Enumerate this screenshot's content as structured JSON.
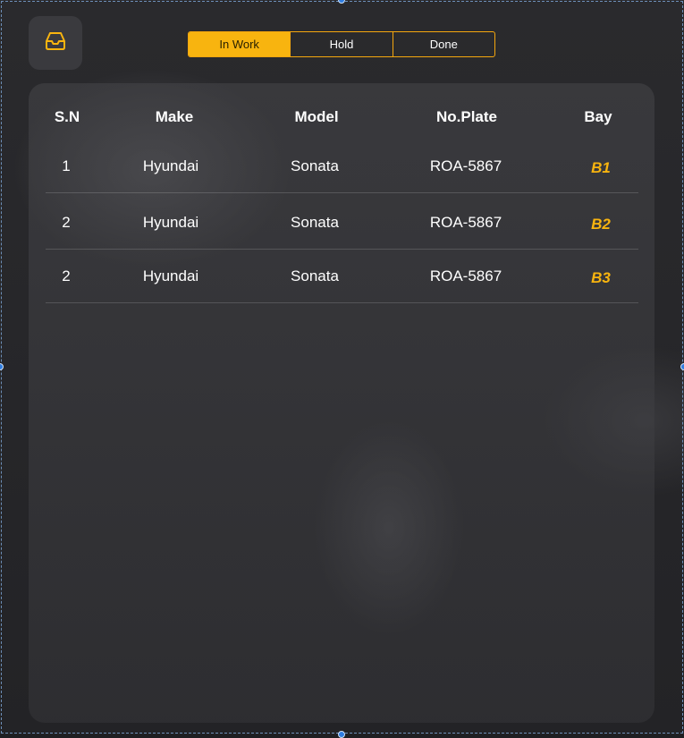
{
  "colors": {
    "accent": "#f8b40f",
    "panel": "#3d3d41",
    "background": "#232326",
    "text": "#ffffff"
  },
  "toolbar": {
    "icon": "inbox-tray-icon",
    "tabs": [
      {
        "label": "In Work",
        "active": true
      },
      {
        "label": "Hold",
        "active": false
      },
      {
        "label": "Done",
        "active": false
      }
    ]
  },
  "table": {
    "headers": [
      "S.N",
      "Make",
      "Model",
      "No.Plate",
      "Bay"
    ],
    "rows": [
      {
        "sn": "1",
        "make": "Hyundai",
        "model": "Sonata",
        "plate": "ROA-5867",
        "bay": "B1"
      },
      {
        "sn": "2",
        "make": "Hyundai",
        "model": "Sonata",
        "plate": "ROA-5867",
        "bay": "B2"
      },
      {
        "sn": "2",
        "make": "Hyundai",
        "model": "Sonata",
        "plate": "ROA-5867",
        "bay": "B3"
      }
    ]
  }
}
